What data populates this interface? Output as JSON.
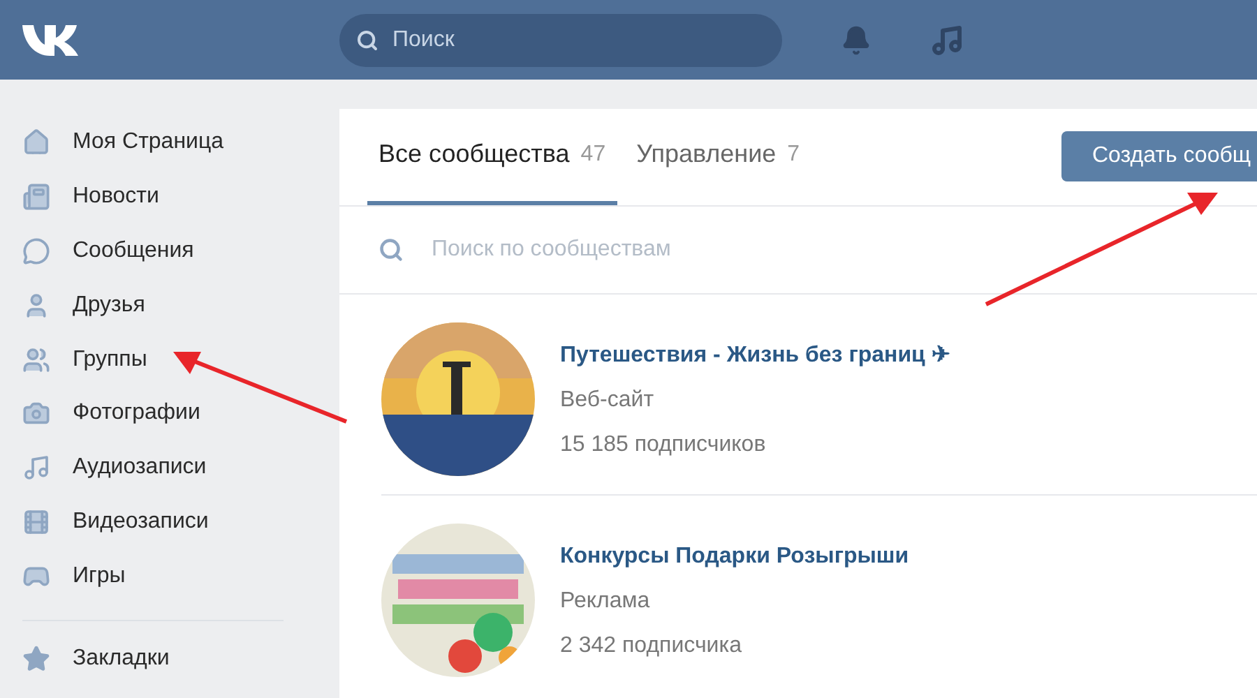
{
  "header": {
    "search": {
      "placeholder": "Поиск"
    }
  },
  "sidebar": {
    "items": [
      {
        "label": "Моя Страница"
      },
      {
        "label": "Новости"
      },
      {
        "label": "Сообщения"
      },
      {
        "label": "Друзья"
      },
      {
        "label": "Группы"
      },
      {
        "label": "Фотографии"
      },
      {
        "label": "Аудиозаписи"
      },
      {
        "label": "Видеозаписи"
      },
      {
        "label": "Игры"
      }
    ],
    "extra_items": [
      {
        "label": "Закладки"
      }
    ]
  },
  "tabs": [
    {
      "label": "Все сообщества",
      "count": "47",
      "selected": true
    },
    {
      "label": "Управление",
      "count": "7",
      "selected": false
    }
  ],
  "create_button": "Создать сообщ",
  "community_search": {
    "placeholder": "Поиск по сообществам"
  },
  "communities": [
    {
      "name": "Путешествия - Жизнь без границ ✈",
      "category": "Веб-сайт",
      "subscribers": "15 185 подписчиков"
    },
    {
      "name": "Конкурсы Подарки Розыгрыши",
      "category": "Реклама",
      "subscribers": "2 342 подписчика"
    }
  ]
}
